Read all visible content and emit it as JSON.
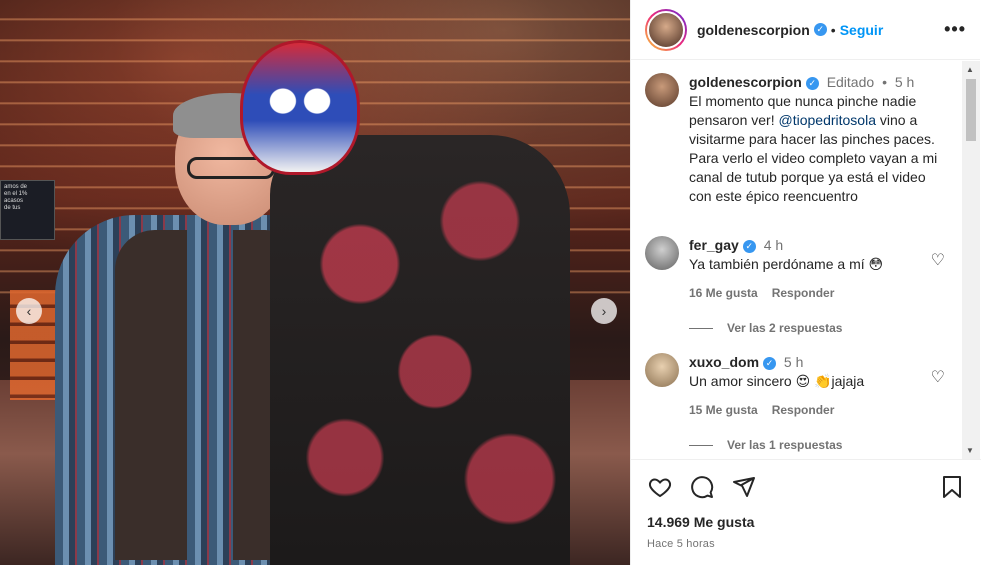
{
  "post": {
    "author": "goldenescorpion",
    "follow_label": "Seguir",
    "more_label": "•••",
    "caption_edited": "Editado",
    "caption_time": "5 h",
    "caption_part1": "El momento que nunca pinche nadie pensaron ver! ",
    "caption_mention": "@tiopedritosola",
    "caption_part2": " vino a visitarme para hacer las pinches paces. Para verlo el video completo vayan a mi canal de tutub porque ya está el video con este épico reencuentro"
  },
  "screen_text": "amos de\nen el 1%\nacasos\nde tus",
  "comments": [
    {
      "user": "fer_gay",
      "time": "4 h",
      "text": "Ya también perdóname a mí 😳",
      "likes": "16 Me gusta",
      "reply": "Responder",
      "view_replies": "Ver las 2 respuestas"
    },
    {
      "user": "xuxo_dom",
      "time": "5 h",
      "text": "Un amor sincero 😍 👏jajaja",
      "likes": "15 Me gusta",
      "reply": "Responder",
      "view_replies": "Ver las 1 respuestas"
    }
  ],
  "footer": {
    "likes": "14.969 Me gusta",
    "time": "Hace 5 horas"
  },
  "icons": [
    "heart-icon",
    "comment-icon",
    "share-icon",
    "bookmark-icon",
    "verified-icon",
    "chevron-left-icon",
    "chevron-right-icon"
  ],
  "colors": {
    "link": "#0095f6",
    "verified": "#3797f0",
    "mention": "#00376b",
    "muted": "#737373"
  }
}
